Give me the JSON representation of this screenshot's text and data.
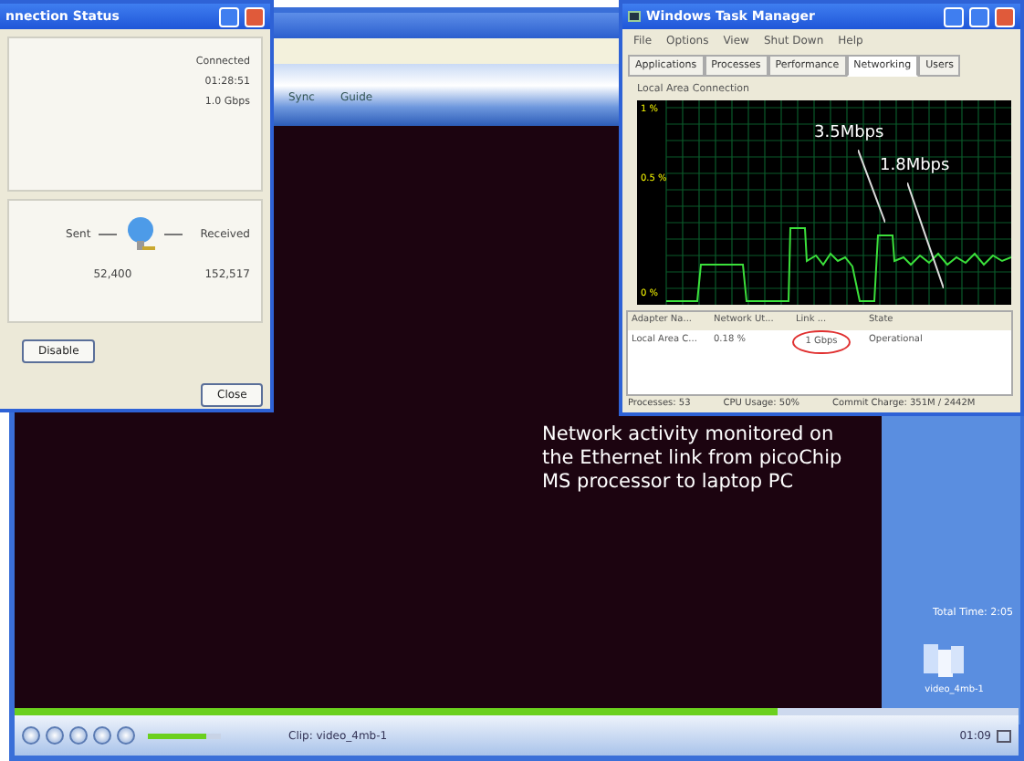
{
  "player": {
    "menu": [
      "Sync",
      "Guide"
    ],
    "caption": "Network activity monitored on the Ethernet link from picoChip MS processor to laptop PC",
    "side_panel": {
      "total": "Total Time: 2:05",
      "item": "video_4mb-1"
    },
    "progress": {
      "level": 0.76
    },
    "volume": {
      "level": 0.8
    },
    "clip": "Clip: video_4mb-1",
    "time": "01:09"
  },
  "status_dialog": {
    "title": "nnection Status",
    "values": [
      "Connected",
      "01:28:51",
      "1.0 Gbps"
    ],
    "sent": "Sent",
    "received": "Received",
    "sent_count": "52,400",
    "received_count": "152,517",
    "buttons": [
      {
        "label": "Disable",
        "kind": "group"
      },
      {
        "label": "Close",
        "kind": "footer"
      }
    ]
  },
  "task_manager": {
    "title": "Windows Task Manager",
    "menu": [
      "File",
      "Options",
      "View",
      "Shut Down",
      "Help"
    ],
    "tabs": [
      {
        "label": "Applications",
        "selected": false
      },
      {
        "label": "Processes",
        "selected": false
      },
      {
        "label": "Performance",
        "selected": false
      },
      {
        "label": "Networking",
        "selected": true
      },
      {
        "label": "Users",
        "selected": false
      }
    ],
    "graph_title": "Local Area Connection",
    "scale": [
      "1 %",
      "0.5 %",
      "0 %"
    ],
    "annotations": [
      "3.5Mbps",
      "1.8Mbps"
    ],
    "columns": [
      "Adapter Na...",
      "Network Ut...",
      "Link ...",
      "State"
    ],
    "rows": [
      {
        "cells": [
          {
            "text": "Local Area C...",
            "circled": false
          },
          {
            "text": "0.18 %",
            "circled": false
          },
          {
            "text": "1 Gbps",
            "circled": true
          },
          {
            "text": "Operational",
            "circled": false
          }
        ]
      }
    ],
    "status": [
      "Processes: 53",
      "CPU Usage: 50%",
      "Commit Charge: 351M / 2442M"
    ]
  }
}
